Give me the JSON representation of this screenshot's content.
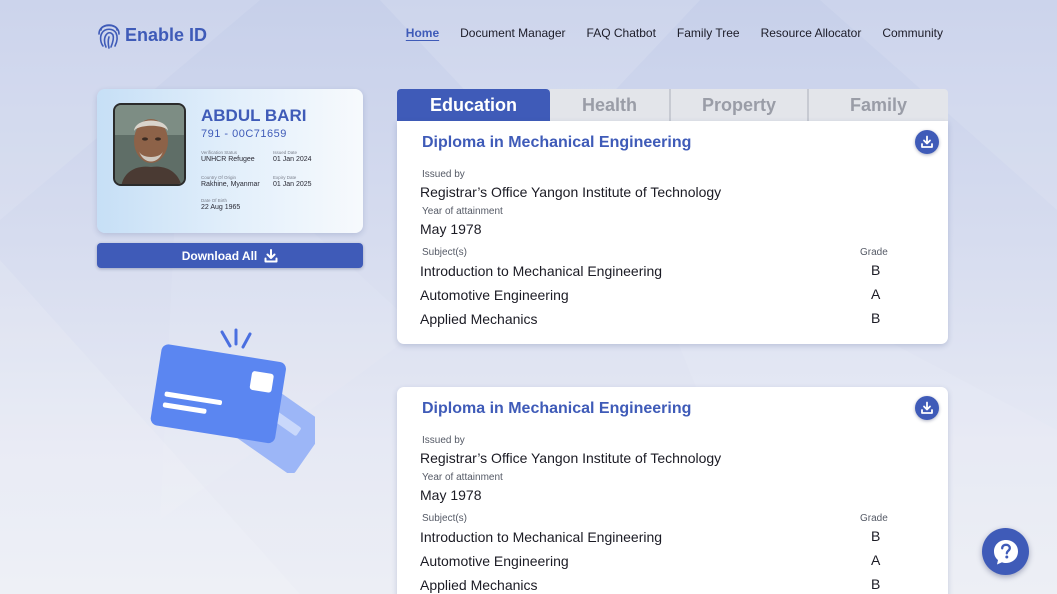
{
  "brand": {
    "name": "Enable ID"
  },
  "nav": {
    "items": [
      {
        "label": "Home",
        "active": true
      },
      {
        "label": "Document Manager"
      },
      {
        "label": "FAQ Chatbot"
      },
      {
        "label": "Family Tree"
      },
      {
        "label": "Resource Allocator"
      },
      {
        "label": "Community"
      }
    ]
  },
  "id_card": {
    "name": "ABDUL BARI",
    "id_number": "791 - 00C71659",
    "fields": [
      {
        "label": "Verification Status",
        "value": "UNHCR Refugee"
      },
      {
        "label": "Issued Date",
        "value": "01 Jan 2024"
      },
      {
        "label": "Country Of Origin",
        "value": "Rakhine, Myanmar"
      },
      {
        "label": "Expiry Date",
        "value": "01 Jan 2025"
      },
      {
        "label": "Date Of Birth",
        "value": "22 Aug 1965"
      }
    ]
  },
  "download_all": {
    "label": "Download All"
  },
  "tabs": [
    {
      "label": "Education",
      "active": true
    },
    {
      "label": "Health"
    },
    {
      "label": "Property"
    },
    {
      "label": "Family"
    }
  ],
  "education": [
    {
      "title": "Diploma in Mechanical Engineering",
      "issued_by_label": "Issued by",
      "issued_by": "Registrar’s Office Yangon Institute of Technology",
      "year_label": "Year of attainment",
      "year": "May 1978",
      "subjects_label": "Subject(s)",
      "grade_label": "Grade",
      "subjects": [
        {
          "name": "Introduction to Mechanical Engineering",
          "grade": "B"
        },
        {
          "name": "Automotive Engineering",
          "grade": "A"
        },
        {
          "name": "Applied Mechanics",
          "grade": "B"
        }
      ]
    },
    {
      "title": "Diploma in Mechanical Engineering",
      "issued_by_label": "Issued by",
      "issued_by": "Registrar’s Office Yangon Institute of Technology",
      "year_label": "Year of attainment",
      "year": "May 1978",
      "subjects_label": "Subject(s)",
      "grade_label": "Grade",
      "subjects": [
        {
          "name": "Introduction to Mechanical Engineering",
          "grade": "B"
        },
        {
          "name": "Automotive Engineering",
          "grade": "A"
        },
        {
          "name": "Applied Mechanics",
          "grade": "B"
        }
      ]
    }
  ],
  "icons": {
    "logo": "fingerprint-icon",
    "download": "download-icon",
    "help": "help-chat-icon",
    "illustration": "id-cards-illustration"
  },
  "colors": {
    "primary": "#3f5bb8",
    "tab_inactive": "#e3e5ea",
    "text": "#1b1b24"
  }
}
